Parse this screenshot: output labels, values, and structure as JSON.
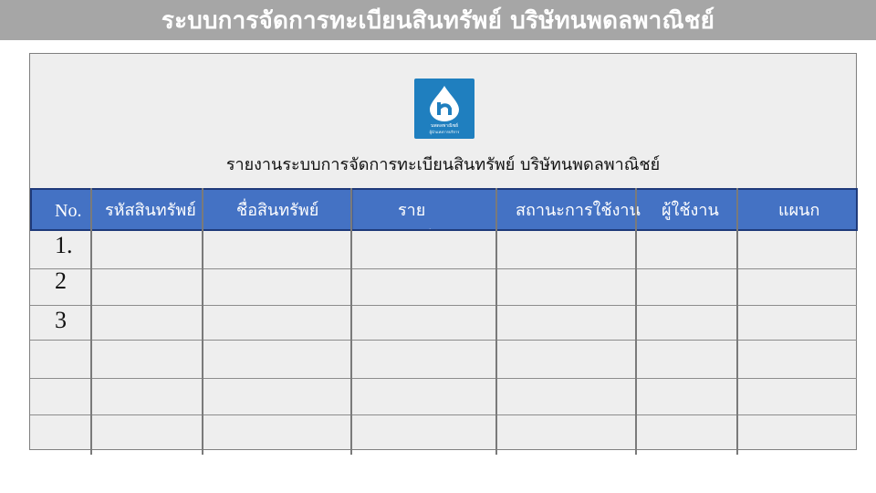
{
  "page": {
    "title": "ระบบการจัดการทะเบียนสินทรัพย์ บริษัทนพดลพาณิชย์"
  },
  "report": {
    "title": "รายงานระบบการจัดการทะเบียนสินทรัพย์ บริษัทนพดลพาณิชย์",
    "logo_text": "นพดลพาณิชย์",
    "logo_subtext": "ผู้นำแห่งการบริการ"
  },
  "table": {
    "columns": [
      {
        "label": "No."
      },
      {
        "label": "รหัสสินทรัพย์"
      },
      {
        "label": "ชื่อสินทรัพย์"
      },
      {
        "label": "รายละเอียด"
      },
      {
        "label": "สถานะการใช้งาน"
      },
      {
        "label": "ผู้ใช้งาน"
      },
      {
        "label": "แผนก"
      }
    ],
    "rows": [
      {
        "no": "1."
      },
      {
        "no": "2"
      },
      {
        "no": "3"
      },
      {
        "no": ""
      },
      {
        "no": ""
      },
      {
        "no": ""
      }
    ]
  },
  "colors": {
    "title_bar": "#a6a6a6",
    "header_bg": "#4472c4",
    "report_bg": "#eeeeee",
    "logo_bg": "#1f7fbf"
  }
}
